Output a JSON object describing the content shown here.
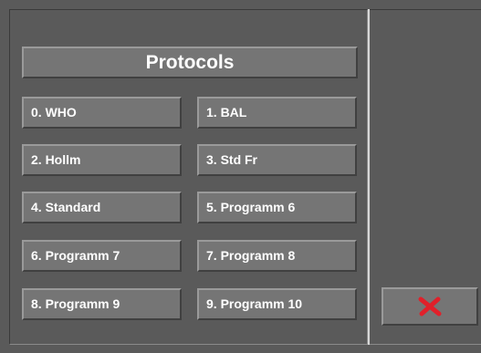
{
  "header": {
    "title": "Protocols"
  },
  "protocols": [
    {
      "label": "0. WHO"
    },
    {
      "label": "1. BAL"
    },
    {
      "label": "2. Hollm"
    },
    {
      "label": "3. Std Fr"
    },
    {
      "label": "4. Standard"
    },
    {
      "label": "5. Programm 6"
    },
    {
      "label": "6. Programm 7"
    },
    {
      "label": "7. Programm 8"
    },
    {
      "label": "8. Programm 9"
    },
    {
      "label": "9. Programm 10"
    }
  ],
  "close_button": {
    "icon": "close-icon",
    "icon_color": "#e0202a"
  },
  "colors": {
    "background": "#5a5a5a",
    "button_face": "#757575",
    "text": "#ffffff"
  }
}
